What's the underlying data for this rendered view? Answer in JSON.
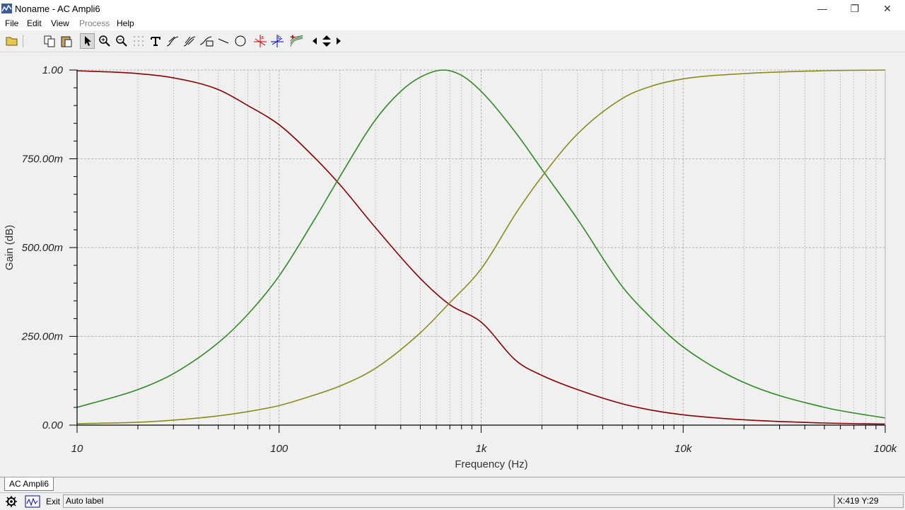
{
  "window": {
    "title": "Noname - AC Ampli6",
    "minimize": "—",
    "restore": "❐",
    "close": "✕"
  },
  "menu": [
    {
      "label": "File",
      "enabled": true
    },
    {
      "label": "Edit",
      "enabled": true
    },
    {
      "label": "View",
      "enabled": true
    },
    {
      "label": "Process",
      "enabled": false
    },
    {
      "label": "Help",
      "enabled": true
    }
  ],
  "toolbar": {
    "buttons": [
      "open-icon",
      "copy-icon",
      "paste-icon",
      "pointer-icon",
      "zoom-in-icon",
      "zoom-out-icon",
      "grid-icon",
      "text-icon",
      "curve-label-icon",
      "curve-label-2-icon",
      "curve-label-3-icon",
      "line-icon",
      "ellipse-icon",
      "cursor-a-icon",
      "cursor-b-icon",
      "add-curve-icon",
      "left-arrow-icon",
      "up-down-arrow-icon",
      "right-arrow-icon"
    ],
    "pressed": "pointer-icon"
  },
  "tab": {
    "label": "AC Ampli6"
  },
  "status": {
    "exit_label": "Exit",
    "field_text": "Auto label",
    "coords": "X:419 Y:29"
  },
  "colors": {
    "lowpass": "#8b0000",
    "bandpass": "#2e8b22",
    "highpass": "#8b8b1a",
    "grid": "#b4b4b4",
    "axis": "#000000"
  },
  "chart_data": {
    "type": "line",
    "xscale": "log",
    "xlabel": "Frequency (Hz)",
    "ylabel": "Gain (dB)",
    "xlim": [
      10,
      100000
    ],
    "ylim": [
      0,
      1
    ],
    "x_ticks": [
      10,
      100,
      1000,
      10000,
      100000
    ],
    "x_tick_labels": [
      "10",
      "100",
      "1k",
      "10k",
      "100k"
    ],
    "y_ticks": [
      0,
      0.25,
      0.5,
      0.75,
      1.0
    ],
    "y_tick_labels": [
      "0.00",
      "250.00m",
      "500.00m",
      "750.00m",
      "1.00"
    ],
    "grid": true,
    "series": [
      {
        "color": "#8b0000",
        "x": [
          10,
          20,
          30,
          50,
          70,
          100,
          150,
          200,
          300,
          500,
          700,
          1000,
          1500,
          2000,
          3000,
          5000,
          7000,
          10000,
          20000,
          50000,
          100000
        ],
        "values": [
          0.998,
          0.99,
          0.978,
          0.945,
          0.9,
          0.846,
          0.753,
          0.677,
          0.556,
          0.413,
          0.339,
          0.29,
          0.18,
          0.14,
          0.1,
          0.06,
          0.042,
          0.029,
          0.015,
          0.006,
          0.003
        ]
      },
      {
        "color": "#2e8b22",
        "x": [
          10,
          20,
          30,
          50,
          70,
          100,
          150,
          200,
          300,
          400,
          500,
          650,
          800,
          1000,
          1500,
          2000,
          3000,
          5000,
          7000,
          10000,
          20000,
          50000,
          100000
        ],
        "values": [
          0.05,
          0.1,
          0.145,
          0.232,
          0.312,
          0.42,
          0.58,
          0.7,
          0.86,
          0.94,
          0.98,
          1.0,
          0.985,
          0.94,
          0.82,
          0.72,
          0.58,
          0.39,
          0.3,
          0.22,
          0.12,
          0.05,
          0.02
        ]
      },
      {
        "color": "#8b8b1a",
        "x": [
          10,
          20,
          30,
          50,
          70,
          100,
          150,
          200,
          300,
          500,
          700,
          1000,
          1500,
          2000,
          3000,
          5000,
          7000,
          10000,
          20000,
          50000,
          100000
        ],
        "values": [
          0.004,
          0.008,
          0.014,
          0.026,
          0.038,
          0.055,
          0.085,
          0.11,
          0.16,
          0.26,
          0.345,
          0.44,
          0.6,
          0.7,
          0.82,
          0.92,
          0.955,
          0.975,
          0.99,
          0.998,
          1.0
        ]
      }
    ]
  }
}
